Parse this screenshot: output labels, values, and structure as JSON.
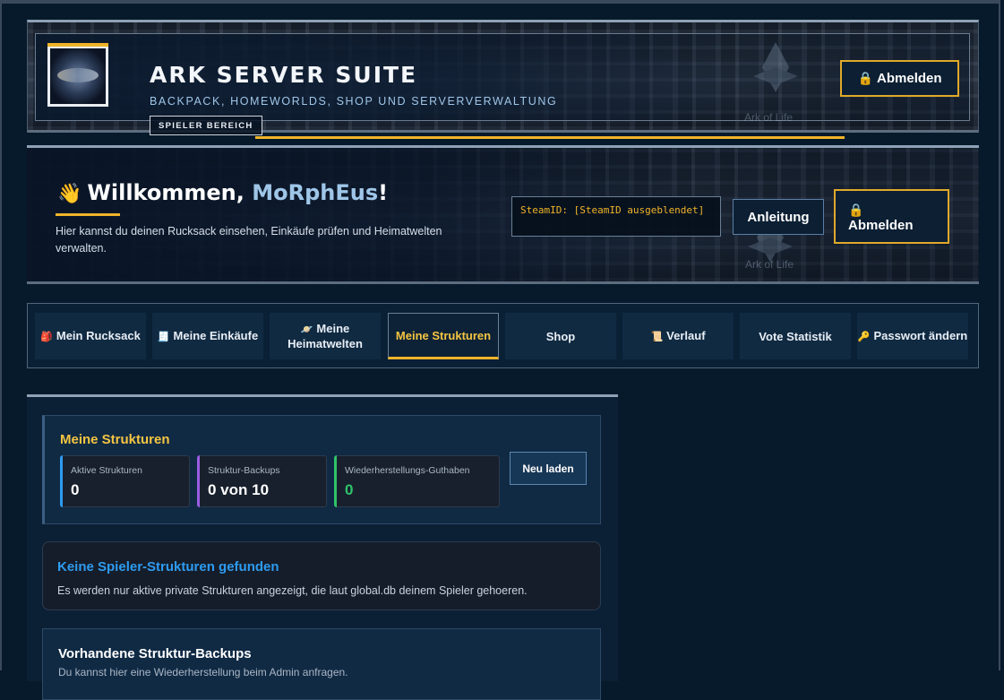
{
  "header": {
    "title": "ARK SERVER SUITE",
    "subtitle": "BACKPACK, HOMEWORLDS, SHOP UND SERVERVERWALTUNG",
    "badge": "SPIELER BEREICH",
    "emblem_text": "Ark of Life",
    "logout_label": "Abmelden"
  },
  "welcome": {
    "greeting": "Willkommen, ",
    "username": "MoRphEus",
    "exclamation": "!",
    "description": "Hier kannst du deinen Rucksack einsehen, Einkäufe prüfen und Heimatwelten verwalten.",
    "steam_id": "SteamID: [SteamID ausgeblendet]",
    "guide_label": "Anleitung",
    "logout_label": "Abmelden",
    "emblem_text": "Ark of Life"
  },
  "tabs": [
    {
      "icon": "🎒",
      "label": "Mein Rucksack",
      "active": false
    },
    {
      "icon": "🧾",
      "label": "Meine Einkäufe",
      "active": false
    },
    {
      "icon": "🪐",
      "label": "Meine Heimatwelten",
      "active": false
    },
    {
      "icon": "",
      "label": "Meine Strukturen",
      "active": true
    },
    {
      "icon": "",
      "label": "Shop",
      "active": false
    },
    {
      "icon": "📜",
      "label": "Verlauf",
      "active": false
    },
    {
      "icon": "",
      "label": "Vote Statistik",
      "active": false
    },
    {
      "icon": "🔑",
      "label": "Passwort ändern",
      "active": false
    }
  ],
  "strukturen": {
    "title": "Meine Strukturen",
    "reload_label": "Neu laden",
    "stats": [
      {
        "label": "Aktive Strukturen",
        "value": "0",
        "accent": "#2e9bf0",
        "value_color": "#ffffff"
      },
      {
        "label": "Struktur-Backups",
        "value": "0 von 10",
        "accent": "#9b5de5",
        "value_color": "#ffffff"
      },
      {
        "label": "Wiederherstellungs-Guthaben",
        "value": "0",
        "accent": "#2fc46a",
        "value_color": "#2fc46a"
      }
    ]
  },
  "empty": {
    "title": "Keine Spieler-Strukturen gefunden",
    "text": "Es werden nur aktive private Strukturen angezeigt, die laut global.db deinem Spieler gehoeren."
  },
  "backups": {
    "title": "Vorhandene Struktur-Backups",
    "text": "Du kannst hier eine Wiederherstellung beim Admin anfragen."
  },
  "colors": {
    "accent_gold": "#f0b429",
    "accent_blue": "#2e9bf0",
    "background": "#071a2b"
  },
  "icons": {
    "lock": "lock-icon",
    "hand": "waving-hand-icon"
  }
}
